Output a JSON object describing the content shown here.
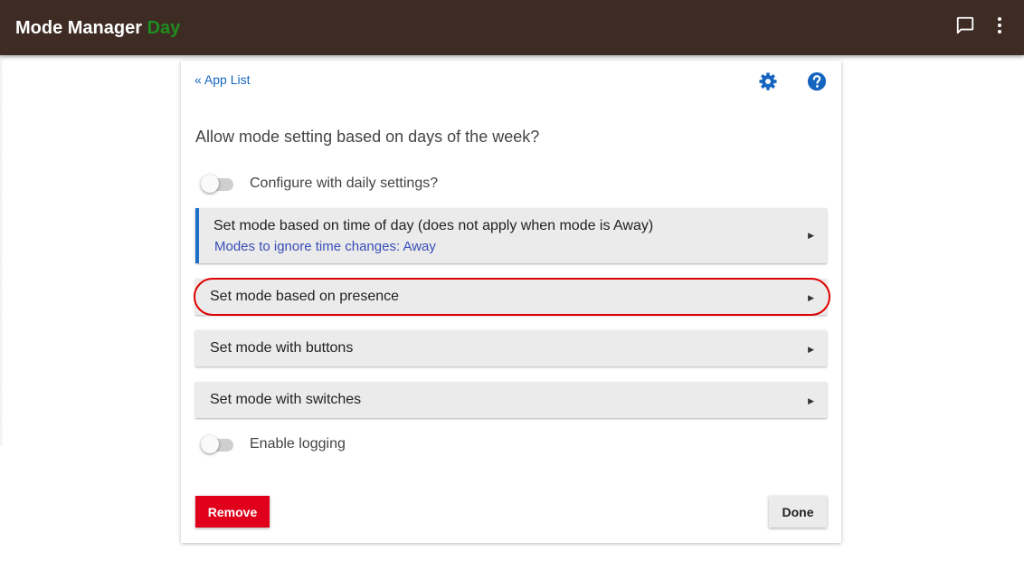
{
  "header": {
    "app_name": "Mode Manager",
    "current_mode": "Day",
    "icons": [
      "chat-icon",
      "more-vert-icon"
    ]
  },
  "page": {
    "back_link": "« App List",
    "icons": [
      "gear-icon",
      "help-icon"
    ],
    "heading": "Allow mode setting based on days of the week?",
    "toggles": {
      "daily_settings": {
        "label": "Configure with daily settings?",
        "on": false
      },
      "logging": {
        "label": "Enable logging",
        "on": false
      }
    },
    "sections": {
      "time_of_day": {
        "label": "Set mode based on time of day (does not apply when mode is Away)",
        "sublabel": "Modes to ignore time changes: Away"
      },
      "presence": {
        "label": "Set mode based on presence"
      },
      "buttons": {
        "label": "Set mode with buttons"
      },
      "switches": {
        "label": "Set mode with switches"
      }
    },
    "arrow": "▶",
    "actions": {
      "remove": "Remove",
      "done": "Done"
    }
  },
  "colors": {
    "header_bg": "#3e2c24",
    "mode_text": "#1e8c1e",
    "link": "#1565c0",
    "accent_border": "#1e6fc8",
    "remove_bg": "#e0001b",
    "highlight": "#e00000"
  }
}
